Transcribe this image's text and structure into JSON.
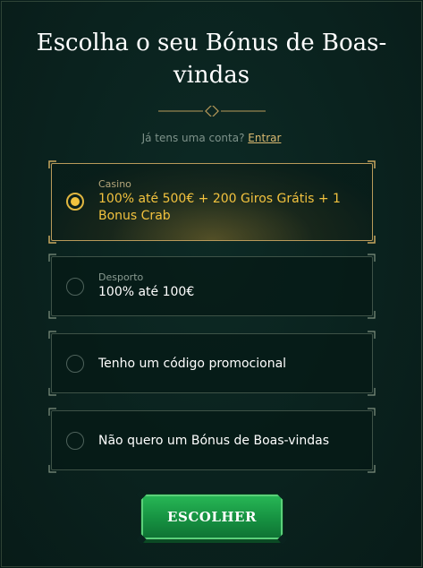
{
  "header": {
    "title": "Escolha o seu Bónus de Boas-vindas"
  },
  "account": {
    "prompt": "Já tens uma conta?",
    "login_label": "Entrar"
  },
  "options": [
    {
      "category": "Casino",
      "value": "100% até 500€ + 200 Giros Grátis + 1 Bonus Crab",
      "selected": true
    },
    {
      "category": "Desporto",
      "value": "100% até 100€",
      "selected": false
    },
    {
      "category": "",
      "value": "Tenho um código promocional",
      "selected": false
    },
    {
      "category": "",
      "value": "Não quero um Bónus de Boas-vindas",
      "selected": false
    }
  ],
  "action": {
    "choose_label": "ESCOLHER"
  },
  "colors": {
    "background": "#0a221e",
    "accent_gold": "#f2c23e",
    "button_green": "#169141"
  }
}
